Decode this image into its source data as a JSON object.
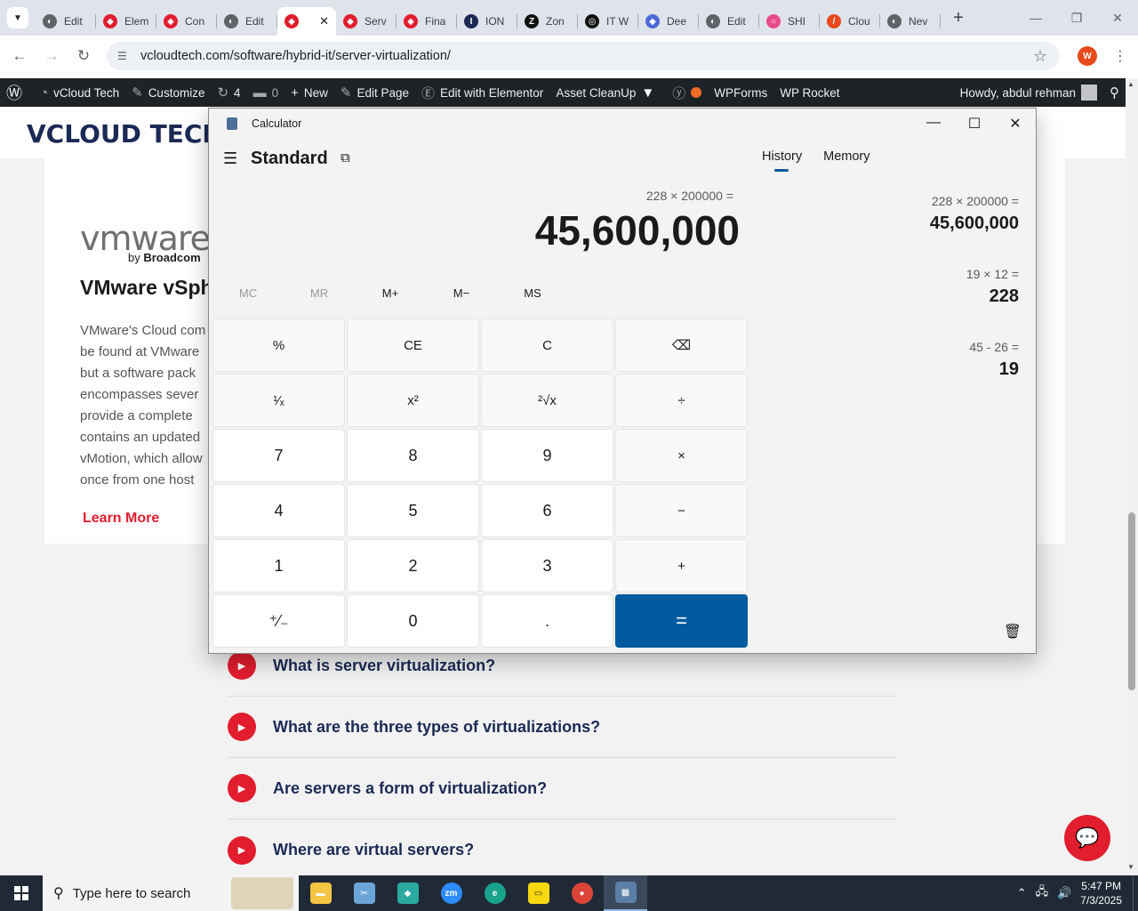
{
  "browser": {
    "tabs": [
      {
        "label": "Edit",
        "color": "#5f6368",
        "glyph": "◐"
      },
      {
        "label": "Elem",
        "color": "#e11d2e",
        "glyph": "◆"
      },
      {
        "label": "Con",
        "color": "#e11d2e",
        "glyph": "◆"
      },
      {
        "label": "Edit",
        "color": "#5f6368",
        "glyph": "◐"
      },
      {
        "label": "",
        "color": "#e11d2e",
        "glyph": "◆",
        "active": true
      },
      {
        "label": "Serv",
        "color": "#e11d2e",
        "glyph": "◆"
      },
      {
        "label": "Fina",
        "color": "#e11d2e",
        "glyph": "◆"
      },
      {
        "label": "ION",
        "color": "#1b2a55",
        "glyph": "I"
      },
      {
        "label": "Zon",
        "color": "#111111",
        "glyph": "Z"
      },
      {
        "label": "IT W",
        "color": "#111111",
        "glyph": "◎"
      },
      {
        "label": "Dee",
        "color": "#4b6bd6",
        "glyph": "◆"
      },
      {
        "label": "Edit",
        "color": "#5f6368",
        "glyph": "◐"
      },
      {
        "label": "SHI",
        "color": "#e84a8a",
        "glyph": "○"
      },
      {
        "label": "Clou",
        "color": "#e8491d",
        "glyph": "/"
      },
      {
        "label": "Nev",
        "color": "#5f6368",
        "glyph": "◐"
      }
    ],
    "url": "vcloudtech.com/software/hybrid-it/server-virtualization/",
    "profile_initial": "W"
  },
  "wpbar": {
    "site": "vCloud Tech",
    "customize": "Customize",
    "updates": "4",
    "comments": "0",
    "new": "New",
    "edit_page": "Edit Page",
    "elementor": "Edit with Elementor",
    "asset_cleanup": "Asset CleanUp",
    "wpforms": "WPForms",
    "wprocket": "WP Rocket",
    "howdy": "Howdy, abdul rehman"
  },
  "page": {
    "logo": "VCLOUD TECH",
    "vmware_logo": "vmware",
    "vmware_by": "by",
    "vmware_broadcom": "Broadcom",
    "card_title": "VMware vSphere",
    "card_lines": [
      "VMware's Cloud com",
      "be found at VMware",
      "but a software pack",
      "encompasses sever",
      "provide a complete",
      "contains an updated",
      "vMotion, which allow",
      "once from one host"
    ],
    "learn_more": "Learn More",
    "faqs": [
      "What is server virtualization?",
      "What are the three types of virtualizations?",
      "Are servers a form of virtualization?",
      "Where are virtual servers?"
    ]
  },
  "calculator": {
    "title": "Calculator",
    "mode": "Standard",
    "expression": "228 × 200000 =",
    "display": "45,600,000",
    "memory": [
      "MC",
      "MR",
      "M+",
      "M−",
      "MS"
    ],
    "keys": [
      "%",
      "CE",
      "C",
      "⌫",
      "¹⁄ₓ",
      "x²",
      "²√x",
      "÷",
      "7",
      "8",
      "9",
      "×",
      "4",
      "5",
      "6",
      "−",
      "1",
      "2",
      "3",
      "+",
      "⁺⁄₋",
      "0",
      ".",
      "="
    ],
    "history_tab": "History",
    "memory_tab": "Memory",
    "history": [
      {
        "expr": "228   ×   200000 =",
        "result": "45,600,000"
      },
      {
        "expr": "19   ×   12 =",
        "result": "228"
      },
      {
        "expr": "45   -   26 =",
        "result": "19"
      }
    ]
  },
  "taskbar": {
    "search_placeholder": "Type here to search",
    "time": "5:47 PM",
    "date": "7/3/2025"
  }
}
